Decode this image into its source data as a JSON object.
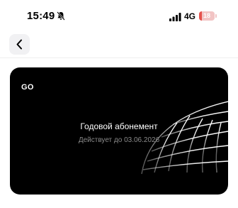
{
  "status_bar": {
    "time": "15:49",
    "network": "4G",
    "battery_level": "18",
    "battery_fraction": 0.18,
    "mute_icon": "bell-slash-icon",
    "signal_icon": "cellular-signal-icon"
  },
  "nav": {
    "back_icon": "chevron-left-icon"
  },
  "card": {
    "logo": "GO",
    "title": "Годовой абонемент",
    "subtitle": "Действует до 03.06.2026",
    "background_color": "#000000",
    "decor_icon": "wireframe-globe-graphic"
  },
  "colors": {
    "battery_low": "#e5524d",
    "card_bg": "#000000",
    "card_text": "#ffffff",
    "card_subtext": "#8a8a8a"
  }
}
